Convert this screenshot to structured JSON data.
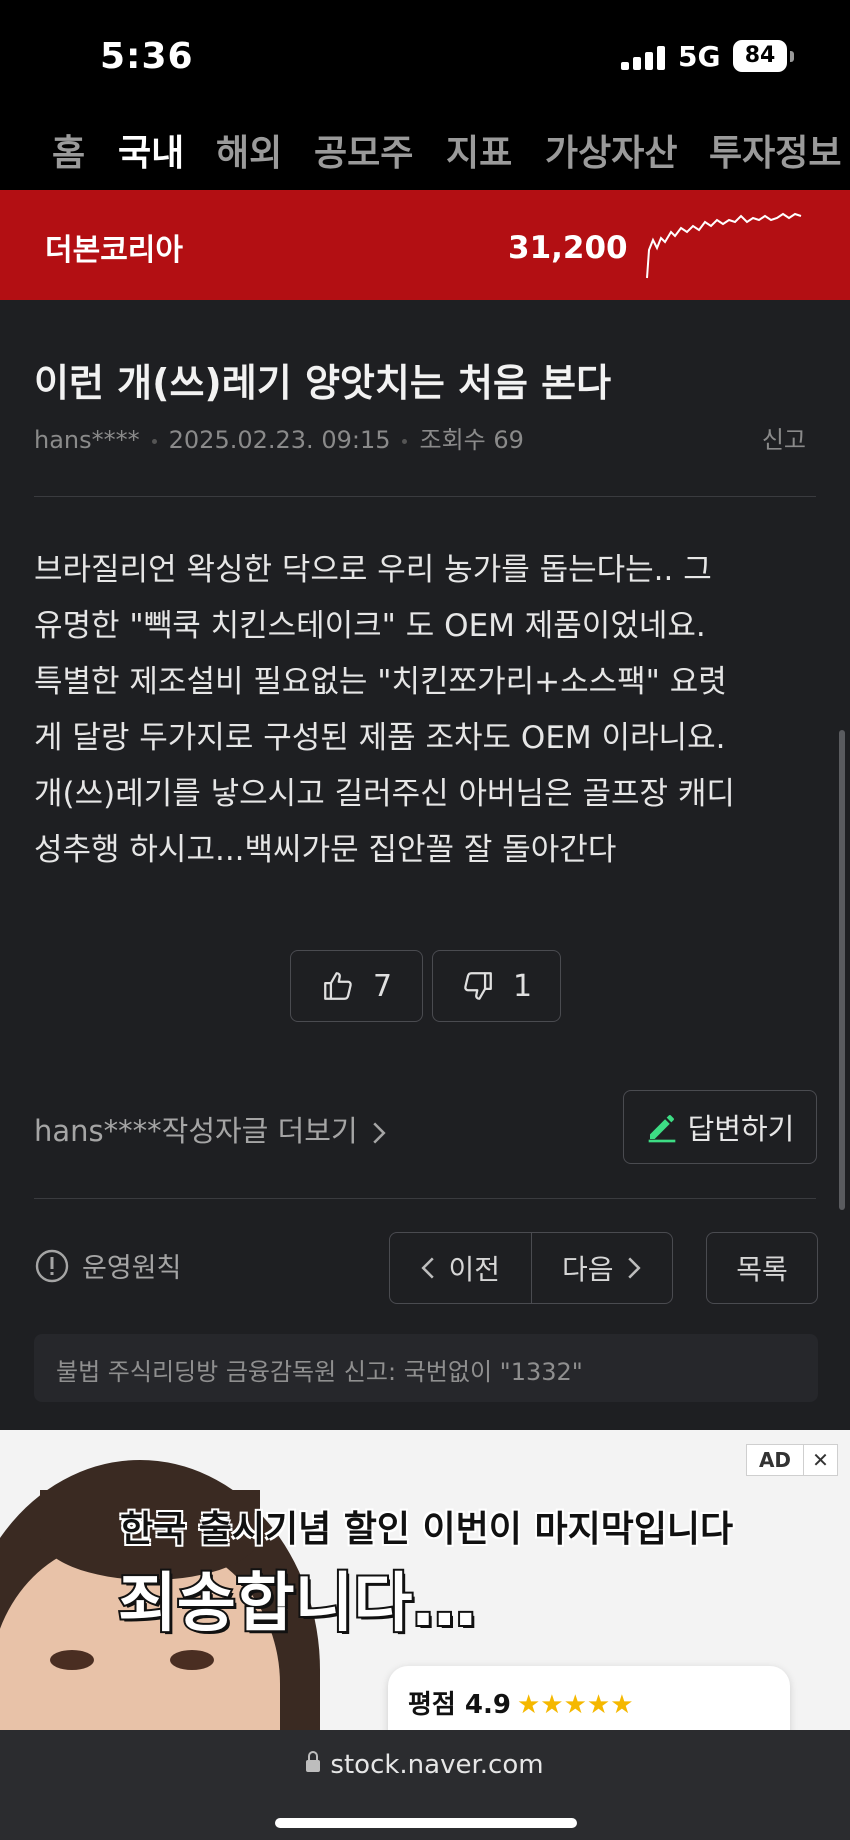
{
  "status_bar": {
    "time": "5:36",
    "network": "5G",
    "battery": "84"
  },
  "nav": {
    "tabs": [
      "홈",
      "국내",
      "해외",
      "공모주",
      "지표",
      "가상자산",
      "투자정보"
    ],
    "active": "국내"
  },
  "stock": {
    "name": "더본코리아",
    "price": "31,200"
  },
  "post": {
    "title": "이런 개(쓰)레기 양앗치는 처음 본다",
    "author": "hans****",
    "datetime": "2025.02.23. 09:15",
    "views_label": "조회수 69",
    "report_label": "신고",
    "body_lines": [
      "브라질리언 왁싱한 닥으로 우리 농가를 돕는다는.. 그",
      "유명한 \"빽쿡 치킨스테이크\" 도 OEM 제품이었네요.",
      "특별한 제조설비 필요없는 \"치킨쪼가리+소스팩\" 요렷",
      "게 달랑 두가지로 구성된 제품 조차도 OEM 이라니요.",
      "개(쓰)레기를 낳으시고 길러주신 아버님은 골프장 캐디",
      "성추행 하시고...백씨가문 집안꼴 잘 돌아간다"
    ],
    "likes": "7",
    "dislikes": "1"
  },
  "actions": {
    "author_more": "hans****작성자글 더보기",
    "reply": "답변하기",
    "rules": "운영원칙",
    "prev": "이전",
    "next": "다음",
    "list": "목록"
  },
  "notice": "불법 주식리딩방 금융감독원 신고: 국번없이 \"1332\"",
  "ad": {
    "badge": "AD",
    "headline": "한국 출시기념 할인 이번이 마지막입니다",
    "subheadline": "죄송합니다…",
    "rating": "평점 4.9",
    "stars": "★★★★★"
  },
  "browser": {
    "url": "stock.naver.com"
  },
  "colors": {
    "accent_red": "#b30f13",
    "reply_icon_green": "#3ddc84",
    "background": "#1e1f22"
  }
}
